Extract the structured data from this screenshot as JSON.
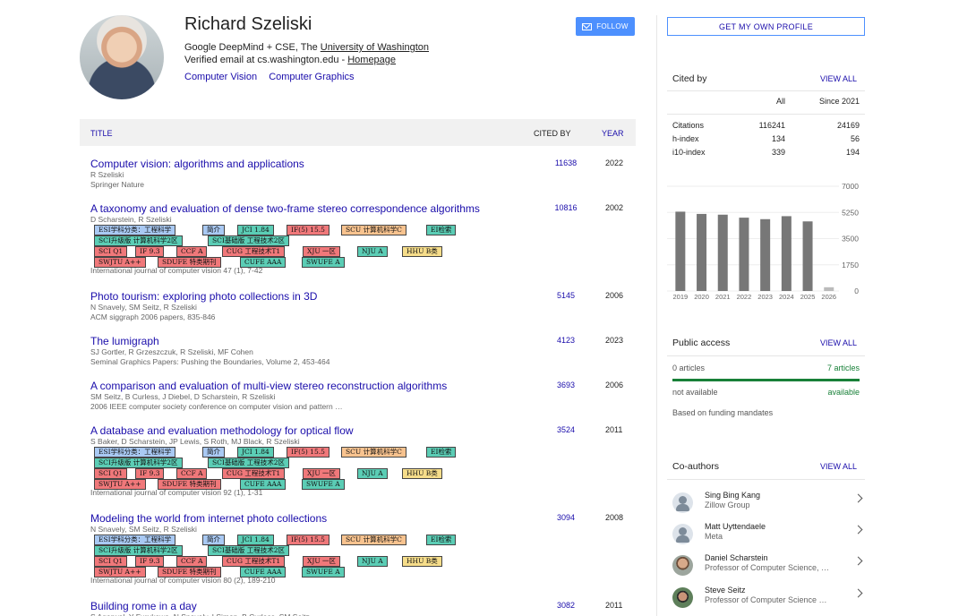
{
  "profile": {
    "name": "Richard Szeliski",
    "affiliation_prefix": "Google DeepMind + CSE, The ",
    "affiliation_link": "University of Washington",
    "email_prefix": "Verified email at cs.washington.edu - ",
    "homepage": "Homepage",
    "interests": [
      "Computer Vision",
      "Computer Graphics"
    ],
    "follow_label": "FOLLOW"
  },
  "table": {
    "col_title": "TITLE",
    "col_cited": "CITED BY",
    "col_year": "YEAR"
  },
  "badge_labels": {
    "esi": "ESI学科分类：工程科学",
    "intro": "简介",
    "jci": "JCI 1.84",
    "if": "IF(5) 15.5",
    "scu": "SCU 计算机科学C",
    "ei": "EI检索",
    "sci_up": "SCI升级版 计算机科学2区",
    "sci_base": "SCI基础版 工程技术2区",
    "sciq1": "SCI Q1",
    "if93": "IF 9.3",
    "ccf": "CCF A",
    "cug": "CUG 工程技术T1",
    "xju": "XJU 一区",
    "nju": "NJU A",
    "hhu": "HHU B类",
    "swjtu": "SWJTU A++",
    "sdufe": "SDUFE 特类期刊",
    "cufe": "CUFE AAA",
    "swufe": "SWUFE A"
  },
  "articles": [
    {
      "title": "Computer vision: algorithms and applications",
      "authors": "R Szeliski",
      "venue": "Springer Nature",
      "cited": "11638",
      "year": "2022"
    },
    {
      "title": "A taxonomy and evaluation of dense two-frame stereo correspondence algorithms",
      "authors": "D Scharstein, R Szeliski",
      "venue": "International journal of computer vision 47 (1), 7-42",
      "cited": "10816",
      "year": "2002"
    },
    {
      "title": "Photo tourism: exploring photo collections in 3D",
      "authors": "N Snavely, SM Seitz, R Szeliski",
      "venue": "ACM siggraph 2006 papers, 835-846",
      "cited": "5145",
      "year": "2006"
    },
    {
      "title": "The lumigraph",
      "authors": "SJ Gortler, R Grzeszczuk, R Szeliski, MF Cohen",
      "venue": "Seminal Graphics Papers: Pushing the Boundaries, Volume 2, 453-464",
      "cited": "4123",
      "year": "2023"
    },
    {
      "title": "A comparison and evaluation of multi-view stereo reconstruction algorithms",
      "authors": "SM Seitz, B Curless, J Diebel, D Scharstein, R Szeliski",
      "venue": "2006 IEEE computer society conference on computer vision and pattern …",
      "cited": "3693",
      "year": "2006"
    },
    {
      "title": "A database and evaluation methodology for optical flow",
      "authors": "S Baker, D Scharstein, JP Lewis, S Roth, MJ Black, R Szeliski",
      "venue": "International journal of computer vision 92 (1), 1-31",
      "cited": "3524",
      "year": "2011"
    },
    {
      "title": "Modeling the world from internet photo collections",
      "authors": "N Snavely, SM Seitz, R Szeliski",
      "venue": "International journal of computer vision 80 (2), 189-210",
      "cited": "3094",
      "year": "2008"
    },
    {
      "title": "Building rome in a day",
      "authors": "S Agarwal, Y Furukawa, N Snavely, I Simon, B Curless, SM Seitz",
      "venue": "",
      "cited": "3082",
      "year": "2011"
    }
  ],
  "right": {
    "get_profile": "GET MY OWN PROFILE",
    "cited_by": "Cited by",
    "view_all": "VIEW ALL",
    "stats_headers": [
      "All",
      "Since 2021"
    ],
    "stats": [
      {
        "label": "Citations",
        "all": "116241",
        "since": "24169"
      },
      {
        "label": "h-index",
        "all": "134",
        "since": "56"
      },
      {
        "label": "i10-index",
        "all": "339",
        "since": "194"
      }
    ],
    "public_access": "Public access",
    "pa_left": "0 articles",
    "pa_right": "7 articles",
    "pa_left2": "not available",
    "pa_right2": "available",
    "mandates": "Based on funding mandates",
    "coauthors_title": "Co-authors",
    "coauthors": [
      {
        "name": "Sing Bing Kang",
        "affil": "Zillow Group",
        "pic": "default"
      },
      {
        "name": "Matt Uyttendaele",
        "affil": "Meta",
        "pic": "default"
      },
      {
        "name": "Daniel Scharstein",
        "affil": "Professor of Computer Science, …",
        "pic": "photo1"
      },
      {
        "name": "Steve Seitz",
        "affil": "Professor of Computer Science …",
        "pic": "photo2"
      }
    ]
  },
  "chart_data": {
    "type": "bar",
    "categories": [
      "2019",
      "2020",
      "2021",
      "2022",
      "2023",
      "2024",
      "2025",
      "2026"
    ],
    "values": [
      5300,
      5150,
      5100,
      4900,
      4800,
      5000,
      4650,
      250
    ],
    "yticks": [
      "7000",
      "5250",
      "3500",
      "1750",
      "0"
    ],
    "ylim": [
      0,
      7000
    ],
    "color": "#777777"
  }
}
